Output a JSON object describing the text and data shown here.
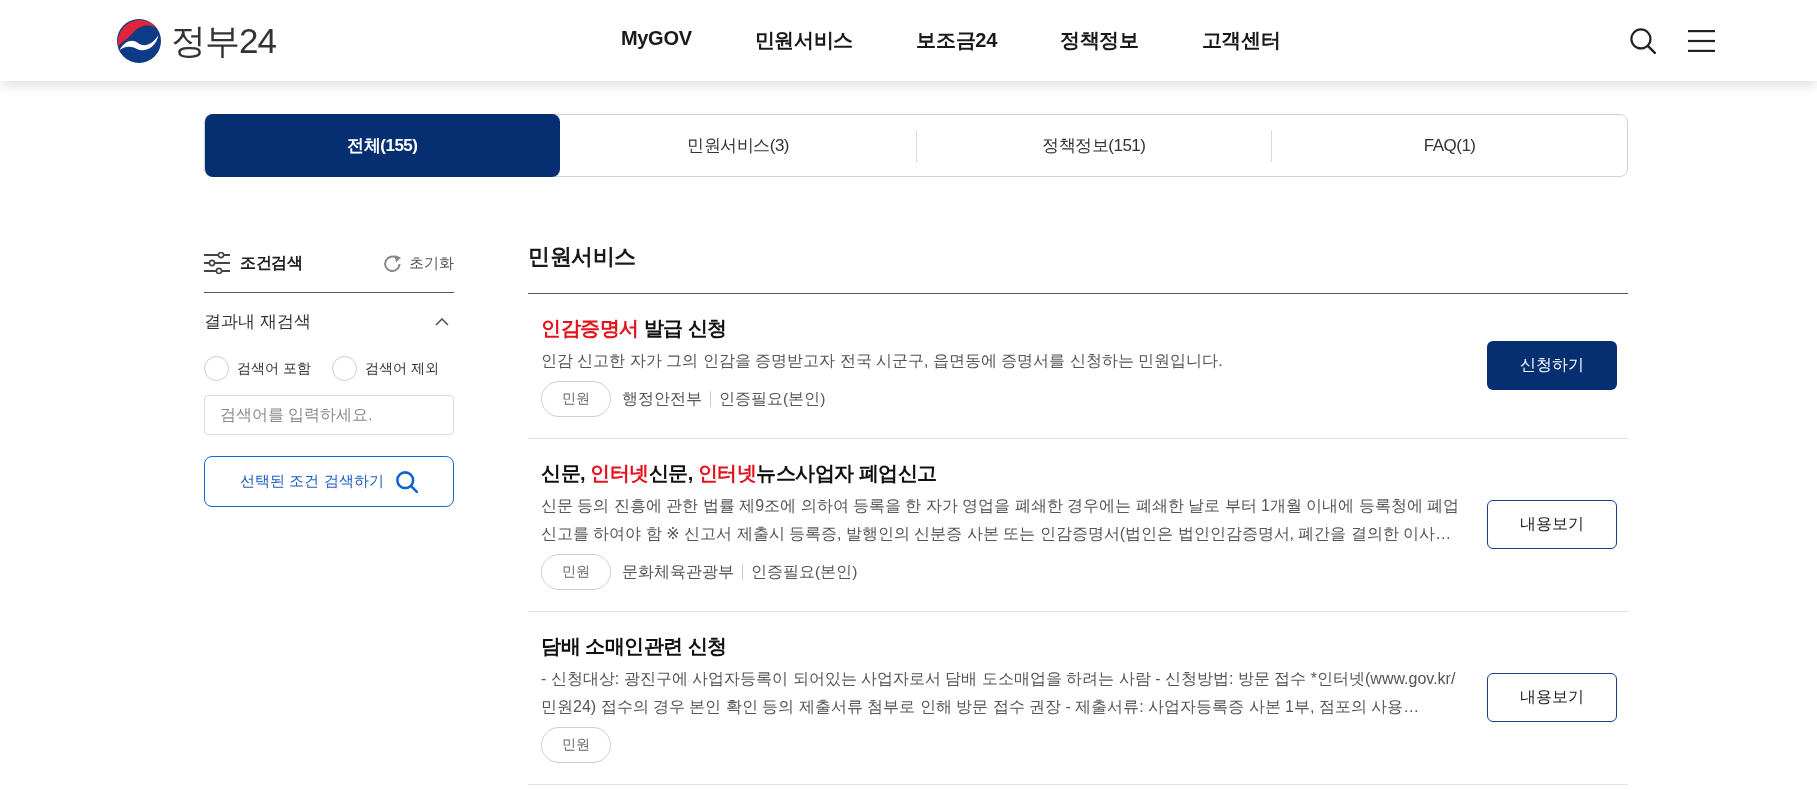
{
  "header": {
    "logo": "정부24",
    "nav": [
      {
        "label": "MyGOV"
      },
      {
        "label": "민원서비스"
      },
      {
        "label": "보조금24"
      },
      {
        "label": "정책정보"
      },
      {
        "label": "고객센터"
      }
    ]
  },
  "tabs": [
    {
      "label": "전체(155)",
      "selected": true
    },
    {
      "label": "민원서비스(3)",
      "selected": false
    },
    {
      "label": "정책정보(151)",
      "selected": false
    },
    {
      "label": "FAQ(1)",
      "selected": false
    }
  ],
  "filter": {
    "title": "조건검색",
    "reset": "초기화",
    "section": {
      "title": "결과내 재검색",
      "expanded": true
    },
    "options": [
      {
        "label": "검색어 포함",
        "selected": false
      },
      {
        "label": "검색어 제외",
        "selected": false
      }
    ],
    "search_field": {
      "placeholder": "검색어를 입력하세요."
    },
    "submit": "선택된 조건 검색하기"
  },
  "results": {
    "heading": "민원서비스",
    "items": [
      {
        "title": [
          {
            "text": "인감증명서",
            "highlight": true
          },
          {
            "text": " 발급 신청",
            "highlight": false
          }
        ],
        "description": "인감 신고한 자가 그의 인감을 증명받고자 전국 시군구, 읍면동에 증명서를 신청하는 민원입니다.",
        "category": "민원",
        "agency": "행정안전부",
        "auth": "인증필요(본인)",
        "action": {
          "label": "신청하기",
          "kind": "primary"
        }
      },
      {
        "title": [
          {
            "text": "신문, ",
            "highlight": false
          },
          {
            "text": "인터넷",
            "highlight": true
          },
          {
            "text": "신문, ",
            "highlight": false
          },
          {
            "text": "인터넷",
            "highlight": true
          },
          {
            "text": "뉴스사업자 폐업신고",
            "highlight": false
          }
        ],
        "description": "신문 등의 진흥에 관한 법률 제9조에 의하여 등록을 한 자가 영업을 폐쇄한 경우에는 폐쇄한 날로 부터 1개월 이내에 등록청에 폐업신고를 하여야 함 ※ 신고서 제출시 등록증, 발행인의 신분증 사본 또는 인감증명서(법인은 법인인감증명서, 폐간을 결의한 이사…",
        "category": "민원",
        "agency": "문화체육관광부",
        "auth": "인증필요(본인)",
        "action": {
          "label": "내용보기",
          "kind": "outline"
        }
      },
      {
        "title": [
          {
            "text": "담배 소매인관련 신청",
            "highlight": false
          }
        ],
        "description": "- 신청대상: 광진구에 사업자등록이 되어있는 사업자로서 담배 도소매업을 하려는 사람 - 신청방법: 방문 접수 *인터넷(www.gov.kr/민원24) 접수의 경우 본인 확인 등의 제출서류 첨부로 인해 방문 접수 권장 - 제출서류: 사업자등록증 사본 1부, 점포의 사용…",
        "category": "민원",
        "action": {
          "label": "내용보기",
          "kind": "outline"
        }
      }
    ]
  }
}
